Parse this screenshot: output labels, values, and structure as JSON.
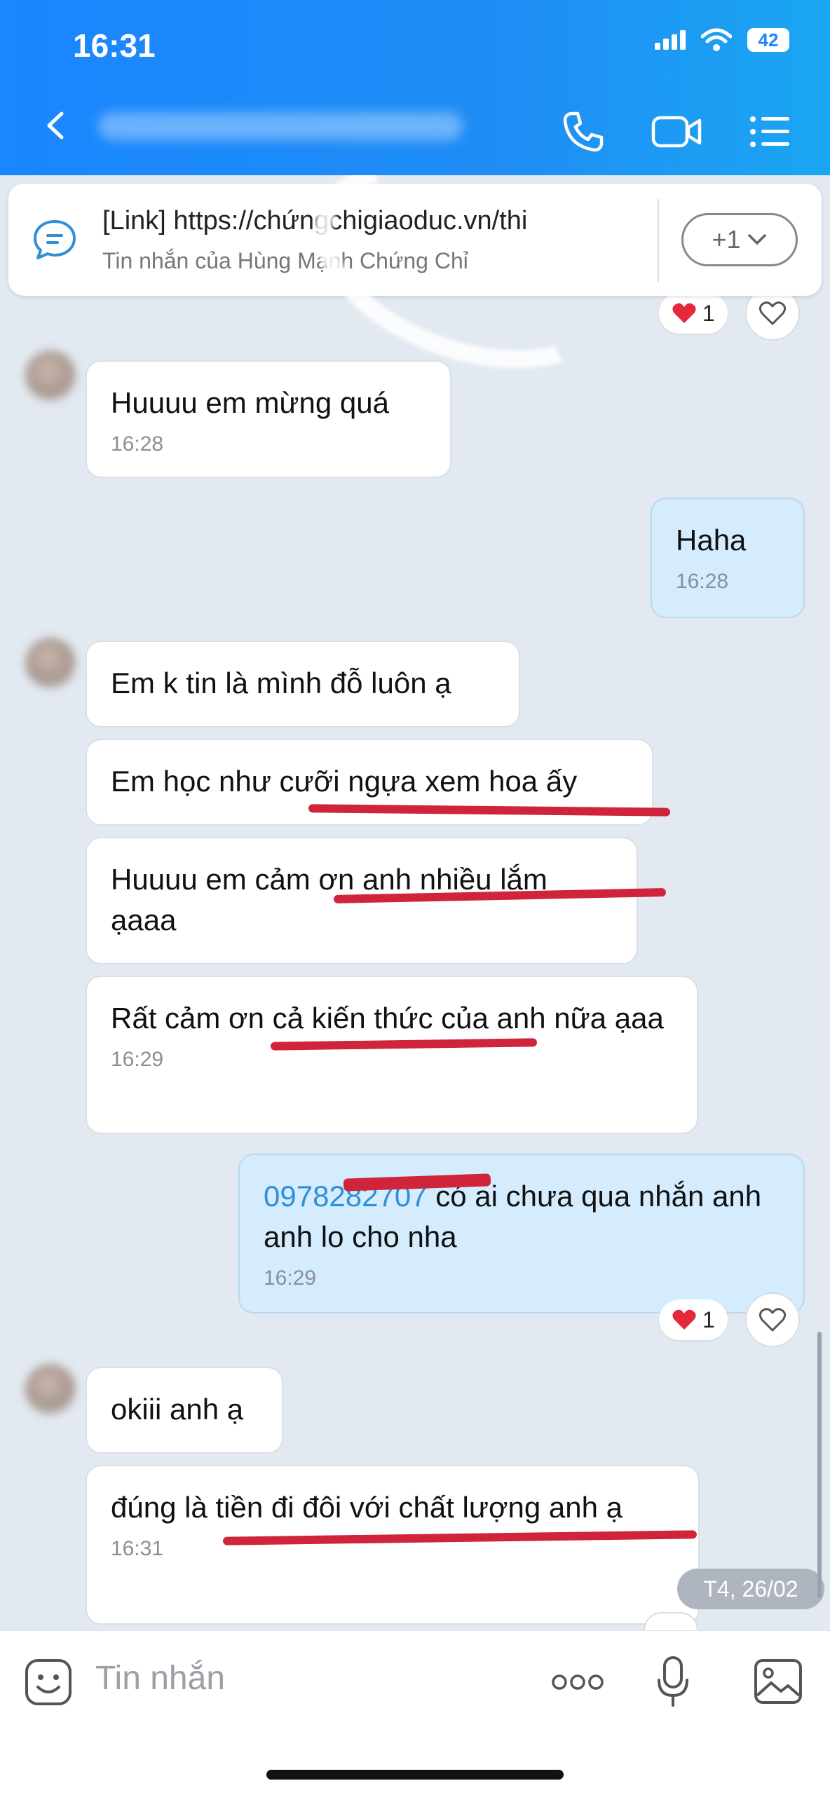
{
  "status_bar": {
    "time": "16:31",
    "battery": "42"
  },
  "header": {
    "contact_name": ""
  },
  "pinned": {
    "title": "[Link] https://chứngchigiaoduc.vn/thi",
    "subtitle": "Tin nhắn của Hùng Mạnh Chứng Chỉ",
    "more_count": "+1"
  },
  "reactions": [
    {
      "count": "1"
    },
    {
      "count": "1"
    }
  ],
  "messages": [
    {
      "text": "Huuuu em mừng quá",
      "time": "16:28"
    },
    {
      "text": "Haha",
      "time": "16:28"
    },
    {
      "text": "Em k tin là mình đỗ luôn ạ"
    },
    {
      "text": "Em học như cưỡi ngựa xem hoa ấy"
    },
    {
      "text": "Huuuu em cảm ơn anh nhiều lắm ạaaa"
    },
    {
      "text": "Rất cảm ơn cả kiến thức của anh nữa ạaa",
      "time": "16:29"
    },
    {
      "phone": "0978282707",
      "text": " có ai chưa qua nhắn anh anh lo cho nha",
      "time": "16:29"
    },
    {
      "text": "okiii anh ạ"
    },
    {
      "text": "đúng là tiền đi đôi với chất lượng anh ạ",
      "time": "16:31"
    }
  ],
  "date_badge": "T4, 26/02",
  "input": {
    "placeholder": "Tin nhắn"
  },
  "icons": [
    "back-icon",
    "phone-icon",
    "video-icon",
    "menu-icon",
    "chat-icon",
    "chevron-down-icon",
    "heart-icon",
    "emoji-icon",
    "more-icon",
    "mic-icon",
    "image-icon"
  ],
  "colors": {
    "header": "#1a86ff",
    "my_bubble": "#d4ecfd",
    "underline": "#d0243a"
  }
}
